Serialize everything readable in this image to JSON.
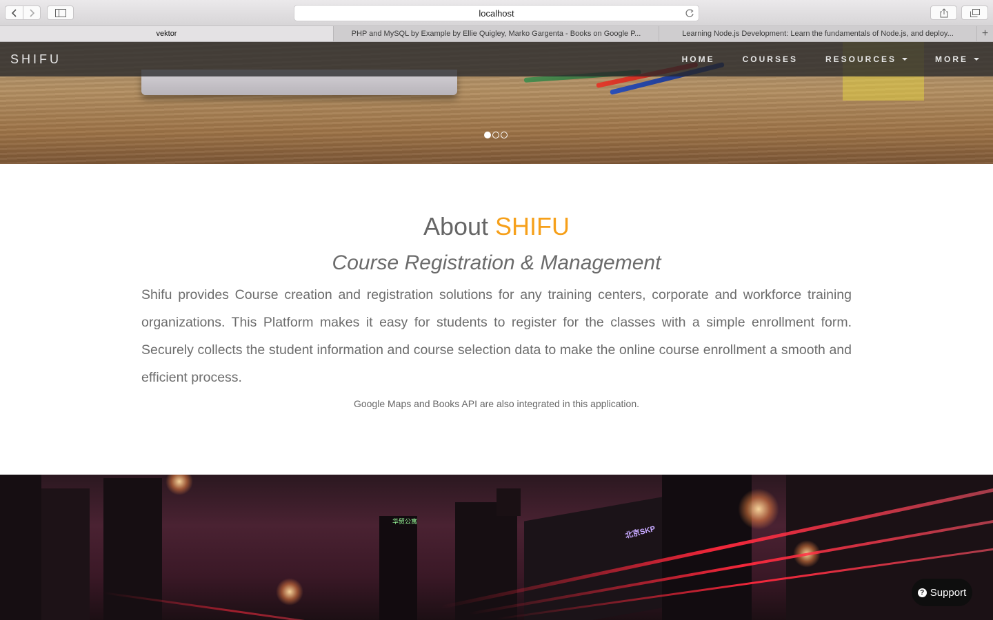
{
  "browser": {
    "url": "localhost",
    "tabs": [
      {
        "label": "vektor",
        "active": true
      },
      {
        "label": "PHP and MySQL by Example by Ellie Quigley, Marko Gargenta - Books on Google P...",
        "active": false
      },
      {
        "label": "Learning Node.js Development: Learn the fundamentals of Node.js, and deploy...",
        "active": false
      }
    ],
    "new_tab_symbol": "+"
  },
  "navbar": {
    "brand": "SHIFU",
    "items": [
      {
        "label": "HOME",
        "dropdown": false
      },
      {
        "label": "COURSES",
        "dropdown": false
      },
      {
        "label": "RESOURCES",
        "dropdown": true
      },
      {
        "label": "MORE",
        "dropdown": true
      }
    ]
  },
  "carousel": {
    "slides": 3,
    "active_index": 0
  },
  "about": {
    "title_prefix": "About",
    "title_accent": "SHIFU",
    "subtitle": "Course Registration & Management",
    "body": "Shifu provides Course creation and registration solutions for any training centers, corporate and workforce training organizations. This Platform makes it easy for students to register for the classes with a simple enrollment form. Securely collects the student information and course selection data to make the online course enrollment a smooth and efficient process.",
    "note": "Google Maps and Books API are also integrated in this application."
  },
  "city_banner": {
    "sign_skp": "北京SKP",
    "sign_green": "华贸公寓"
  },
  "support": {
    "label": "Support",
    "icon": "question-circle-icon"
  },
  "colors": {
    "accent": "#f6a01a",
    "navbar_bg": "rgba(40,40,42,0.78)",
    "support_bg": "#0e0e0e"
  }
}
